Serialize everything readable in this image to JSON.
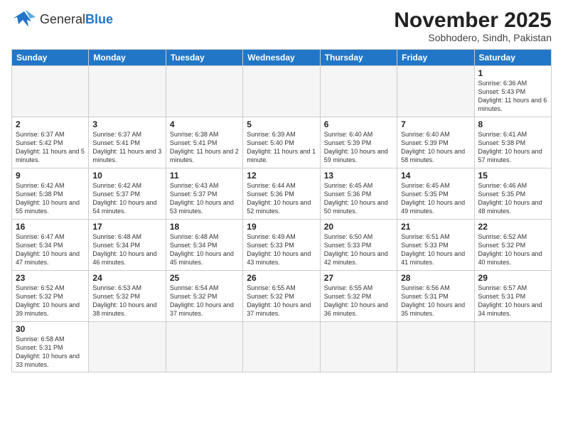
{
  "header": {
    "logo_general": "General",
    "logo_blue": "Blue",
    "title": "November 2025",
    "subtitle": "Sobhodero, Sindh, Pakistan"
  },
  "weekdays": [
    "Sunday",
    "Monday",
    "Tuesday",
    "Wednesday",
    "Thursday",
    "Friday",
    "Saturday"
  ],
  "days": {
    "1": {
      "sunrise": "6:36 AM",
      "sunset": "5:43 PM",
      "daylight": "11 hours and 6 minutes."
    },
    "2": {
      "sunrise": "6:37 AM",
      "sunset": "5:42 PM",
      "daylight": "11 hours and 5 minutes."
    },
    "3": {
      "sunrise": "6:37 AM",
      "sunset": "5:41 PM",
      "daylight": "11 hours and 3 minutes."
    },
    "4": {
      "sunrise": "6:38 AM",
      "sunset": "5:41 PM",
      "daylight": "11 hours and 2 minutes."
    },
    "5": {
      "sunrise": "6:39 AM",
      "sunset": "5:40 PM",
      "daylight": "11 hours and 1 minute."
    },
    "6": {
      "sunrise": "6:40 AM",
      "sunset": "5:39 PM",
      "daylight": "10 hours and 59 minutes."
    },
    "7": {
      "sunrise": "6:40 AM",
      "sunset": "5:39 PM",
      "daylight": "10 hours and 58 minutes."
    },
    "8": {
      "sunrise": "6:41 AM",
      "sunset": "5:38 PM",
      "daylight": "10 hours and 57 minutes."
    },
    "9": {
      "sunrise": "6:42 AM",
      "sunset": "5:38 PM",
      "daylight": "10 hours and 55 minutes."
    },
    "10": {
      "sunrise": "6:42 AM",
      "sunset": "5:37 PM",
      "daylight": "10 hours and 54 minutes."
    },
    "11": {
      "sunrise": "6:43 AM",
      "sunset": "5:37 PM",
      "daylight": "10 hours and 53 minutes."
    },
    "12": {
      "sunrise": "6:44 AM",
      "sunset": "5:36 PM",
      "daylight": "10 hours and 52 minutes."
    },
    "13": {
      "sunrise": "6:45 AM",
      "sunset": "5:36 PM",
      "daylight": "10 hours and 50 minutes."
    },
    "14": {
      "sunrise": "6:45 AM",
      "sunset": "5:35 PM",
      "daylight": "10 hours and 49 minutes."
    },
    "15": {
      "sunrise": "6:46 AM",
      "sunset": "5:35 PM",
      "daylight": "10 hours and 48 minutes."
    },
    "16": {
      "sunrise": "6:47 AM",
      "sunset": "5:34 PM",
      "daylight": "10 hours and 47 minutes."
    },
    "17": {
      "sunrise": "6:48 AM",
      "sunset": "5:34 PM",
      "daylight": "10 hours and 46 minutes."
    },
    "18": {
      "sunrise": "6:48 AM",
      "sunset": "5:34 PM",
      "daylight": "10 hours and 45 minutes."
    },
    "19": {
      "sunrise": "6:49 AM",
      "sunset": "5:33 PM",
      "daylight": "10 hours and 43 minutes."
    },
    "20": {
      "sunrise": "6:50 AM",
      "sunset": "5:33 PM",
      "daylight": "10 hours and 42 minutes."
    },
    "21": {
      "sunrise": "6:51 AM",
      "sunset": "5:33 PM",
      "daylight": "10 hours and 41 minutes."
    },
    "22": {
      "sunrise": "6:52 AM",
      "sunset": "5:32 PM",
      "daylight": "10 hours and 40 minutes."
    },
    "23": {
      "sunrise": "6:52 AM",
      "sunset": "5:32 PM",
      "daylight": "10 hours and 39 minutes."
    },
    "24": {
      "sunrise": "6:53 AM",
      "sunset": "5:32 PM",
      "daylight": "10 hours and 38 minutes."
    },
    "25": {
      "sunrise": "6:54 AM",
      "sunset": "5:32 PM",
      "daylight": "10 hours and 37 minutes."
    },
    "26": {
      "sunrise": "6:55 AM",
      "sunset": "5:32 PM",
      "daylight": "10 hours and 37 minutes."
    },
    "27": {
      "sunrise": "6:55 AM",
      "sunset": "5:32 PM",
      "daylight": "10 hours and 36 minutes."
    },
    "28": {
      "sunrise": "6:56 AM",
      "sunset": "5:31 PM",
      "daylight": "10 hours and 35 minutes."
    },
    "29": {
      "sunrise": "6:57 AM",
      "sunset": "5:31 PM",
      "daylight": "10 hours and 34 minutes."
    },
    "30": {
      "sunrise": "6:58 AM",
      "sunset": "5:31 PM",
      "daylight": "10 hours and 33 minutes."
    }
  }
}
